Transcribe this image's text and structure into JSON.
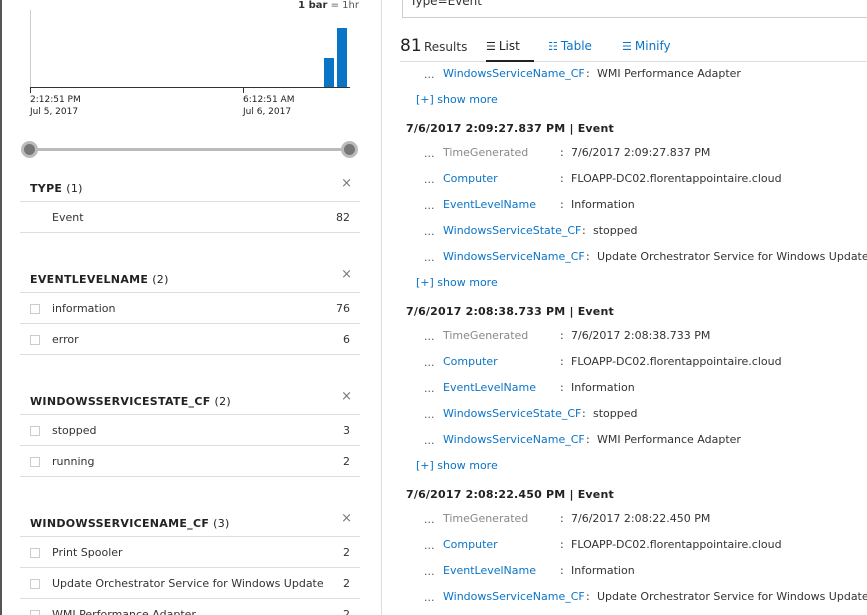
{
  "histogram": {
    "scale_bold": "1 bar",
    "scale_rest": " = 1hr",
    "bars": [
      0.39,
      0.77
    ],
    "tick1_time": "2:12:51 PM",
    "tick1_date": "Jul 5, 2017",
    "tick2_time": "6:12:51 AM",
    "tick2_date": "Jul 6, 2017"
  },
  "facets": [
    {
      "title": "TYPE",
      "count": "(1)",
      "close": "×",
      "rows": [
        {
          "label": "Event",
          "value": "82",
          "checkbox": false
        }
      ]
    },
    {
      "title": "EVENTLEVELNAME",
      "count": "(2)",
      "close": "×",
      "rows": [
        {
          "label": "information",
          "value": "76",
          "checkbox": true
        },
        {
          "label": "error",
          "value": "6",
          "checkbox": true
        }
      ]
    },
    {
      "title": "WINDOWSSERVICESTATE_CF",
      "count": "(2)",
      "close": "×",
      "rows": [
        {
          "label": "stopped",
          "value": "3",
          "checkbox": true
        },
        {
          "label": "running",
          "value": "2",
          "checkbox": true
        }
      ]
    },
    {
      "title": "WINDOWSSERVICENAME_CF",
      "count": "(3)",
      "close": "×",
      "rows": [
        {
          "label": "Print Spooler",
          "value": "2",
          "checkbox": true
        },
        {
          "label": "Update Orchestrator Service for Windows Update",
          "value": "2",
          "checkbox": true
        },
        {
          "label": "WMI Performance Adapter",
          "value": "2",
          "checkbox": true
        }
      ]
    }
  ],
  "search": {
    "query": "Type=Event"
  },
  "results": {
    "count": "81",
    "word": "Results",
    "tabs": {
      "list": "List",
      "table": "Table",
      "minify": "Minify"
    }
  },
  "feed": {
    "dots": "...",
    "show_more": "[+] show more",
    "first_field": {
      "key": "WindowsServiceName_CF",
      "sep": ":",
      "value": "WMI Performance Adapter"
    },
    "records": [
      {
        "header": "7/6/2017 2:09:27.837 PM | Event",
        "fields": [
          {
            "key": "TimeGenerated",
            "sep": ":",
            "value": "7/6/2017 2:09:27.837 PM",
            "grey": true
          },
          {
            "key": "Computer",
            "sep": ":",
            "value": "FLOAPP-DC02.florentappointaire.cloud"
          },
          {
            "key": "EventLevelName",
            "sep": ":",
            "value": "Information"
          },
          {
            "key": "WindowsServiceState_CF",
            "sep": ":",
            "value": "stopped"
          },
          {
            "key": "WindowsServiceName_CF",
            "sep": ":",
            "value": "Update Orchestrator Service for Windows Update"
          }
        ]
      },
      {
        "header": "7/6/2017 2:08:38.733 PM | Event",
        "fields": [
          {
            "key": "TimeGenerated",
            "sep": ":",
            "value": "7/6/2017 2:08:38.733 PM",
            "grey": true
          },
          {
            "key": "Computer",
            "sep": ":",
            "value": "FLOAPP-DC02.florentappointaire.cloud"
          },
          {
            "key": "EventLevelName",
            "sep": ":",
            "value": "Information"
          },
          {
            "key": "WindowsServiceState_CF",
            "sep": ":",
            "value": "stopped"
          },
          {
            "key": "WindowsServiceName_CF",
            "sep": ":",
            "value": "WMI Performance Adapter"
          }
        ]
      },
      {
        "header": "7/6/2017 2:08:22.450 PM | Event",
        "fields": [
          {
            "key": "TimeGenerated",
            "sep": ":",
            "value": "7/6/2017 2:08:22.450 PM",
            "grey": true
          },
          {
            "key": "Computer",
            "sep": ":",
            "value": "FLOAPP-DC02.florentappointaire.cloud"
          },
          {
            "key": "EventLevelName",
            "sep": ":",
            "value": "Information"
          },
          {
            "key": "WindowsServiceName_CF",
            "sep": ":",
            "value": "Update Orchestrator Service for Windows Update"
          }
        ]
      }
    ]
  },
  "colors": {
    "accent": "#0a74c7",
    "bar": "#0a74c7"
  }
}
